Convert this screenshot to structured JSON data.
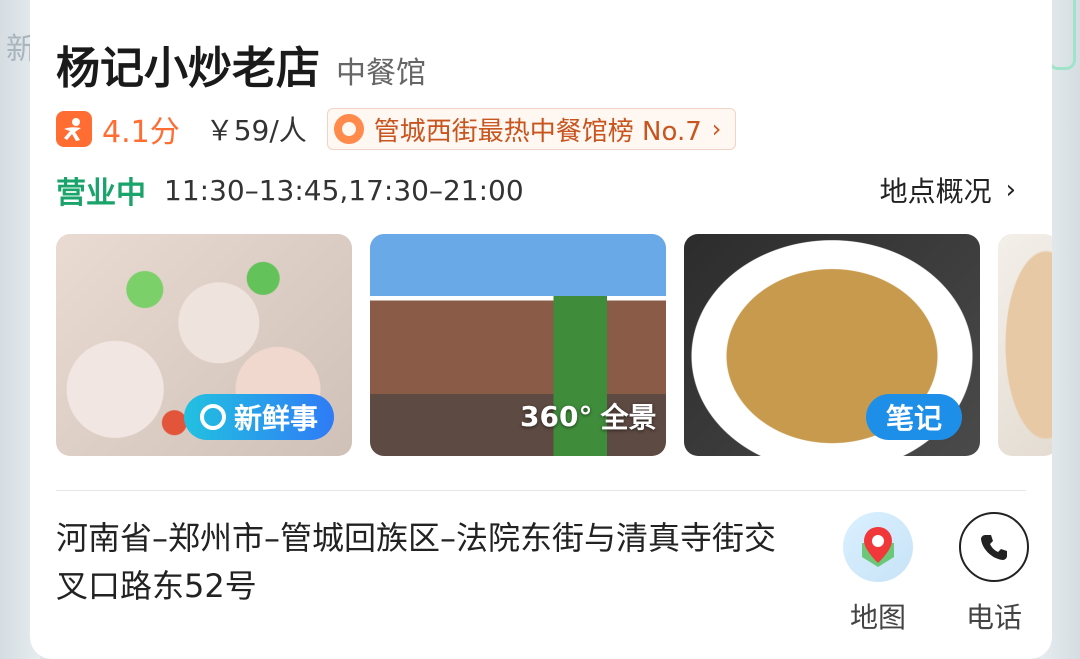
{
  "shop": {
    "name": "杨记小炒老店",
    "category": "中餐馆",
    "score": "4.1分",
    "price": "￥59/人",
    "rank_tag": "管城西街最热中餐馆榜 No.7",
    "open_status": "营业中",
    "hours": "11:30–13:45,17:30–21:00",
    "overview_link": "地点概况"
  },
  "photos": {
    "badge_fresh": "新鲜事",
    "badge_360_deg": "360°",
    "badge_360": "全景",
    "badge_note": "笔记"
  },
  "address": "河南省–郑州市–管城回族区–法院东街与清真寺街交叉口路东52号",
  "actions": {
    "map_label": "地图",
    "phone_label": "电话"
  },
  "background": {
    "map_ghost_text": "新"
  },
  "colors": {
    "accent_orange": "#ff6d33",
    "open_green": "#1aa36a",
    "note_blue": "#1e8fe8"
  },
  "icons": [
    "dianping-icon",
    "rank-badge-icon",
    "chevron-right-icon",
    "map-pin-icon",
    "phone-icon",
    "fresh-news-icon"
  ]
}
